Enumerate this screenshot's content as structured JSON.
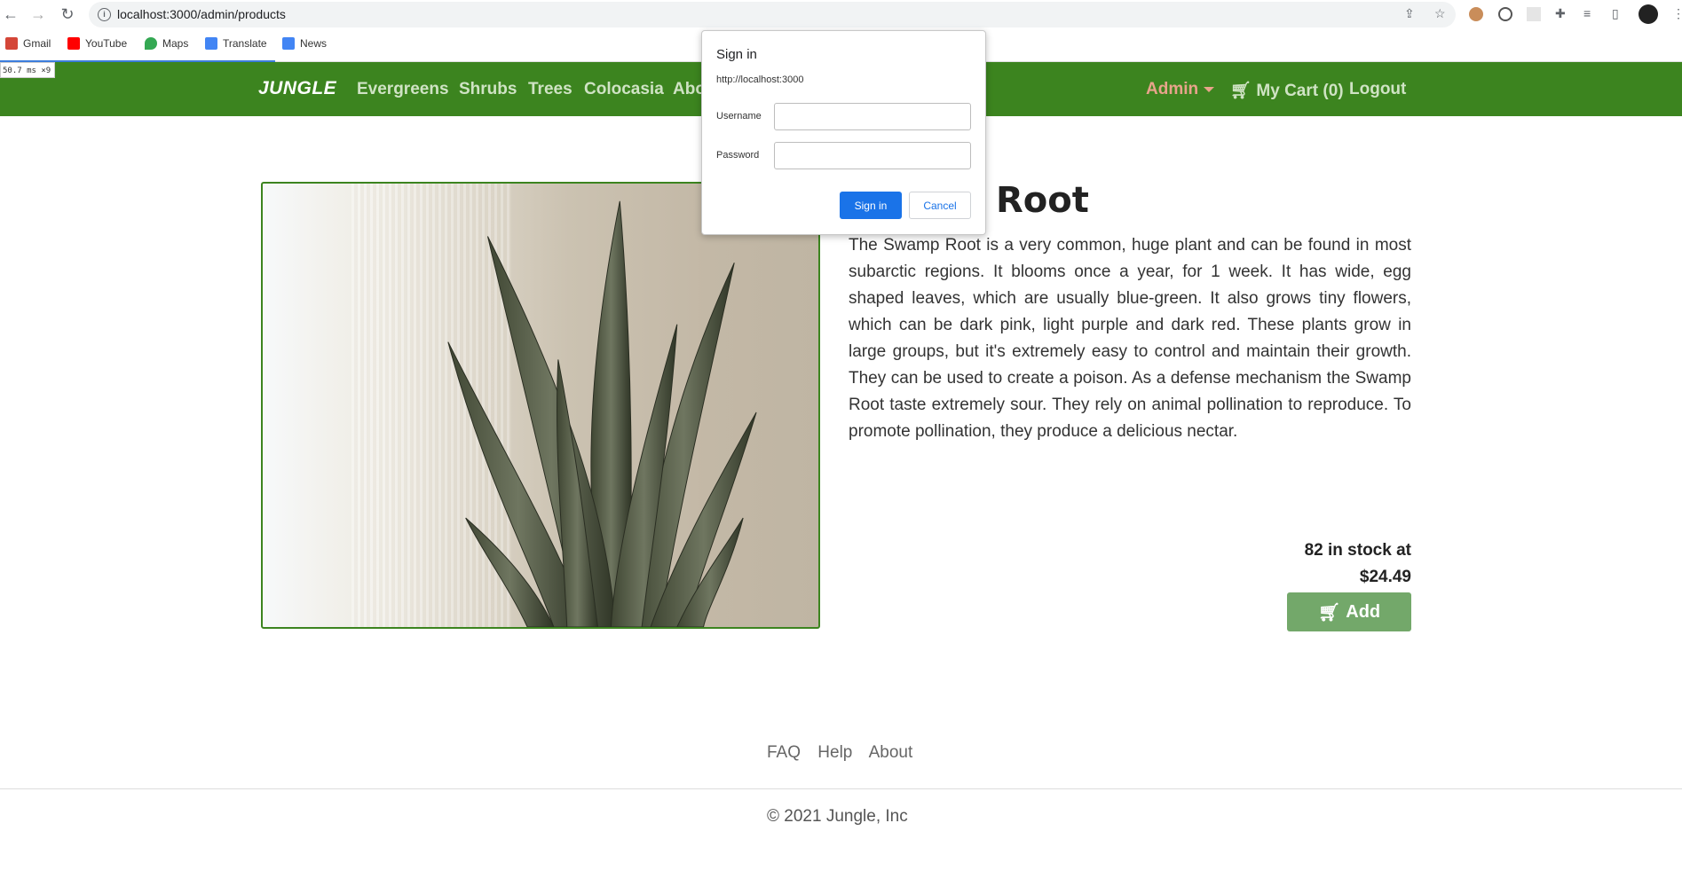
{
  "browser": {
    "url": "localhost:3000/admin/products",
    "bookmarks": [
      {
        "label": "Gmail",
        "icon": "gmail-icon",
        "color": "#d44638"
      },
      {
        "label": "YouTube",
        "icon": "youtube-icon",
        "color": "#ff0000"
      },
      {
        "label": "Maps",
        "icon": "maps-icon",
        "color": "#34a853"
      },
      {
        "label": "Translate",
        "icon": "translate-icon",
        "color": "#4285f4"
      },
      {
        "label": "News",
        "icon": "news-icon",
        "color": "#4285f4"
      }
    ],
    "timing": "50.7 ms ×9"
  },
  "site": {
    "brand": "JUNGLE",
    "nav": {
      "evergreens": "Evergreens",
      "shrubs": "Shrubs",
      "trees": "Trees",
      "colocasia": "Colocasia",
      "about": "Abo",
      "admin": "Admin",
      "cart": "My Cart (0)",
      "logout": "Logout"
    },
    "colors": {
      "nav_bg": "#3c841f",
      "add_button": "#73a86a",
      "admin": "#e8a48b"
    }
  },
  "product": {
    "title": "Root",
    "description": "The Swamp Root is a very common, huge plant and can be found in most subarctic regions. It blooms once a year, for 1 week. It has wide, egg shaped leaves, which are usually blue-green. It also grows tiny flowers, which can be dark pink, light purple and dark red. These plants grow in large groups, but it's extremely easy to control and maintain their growth. They can be used to create a poison. As a defense mechanism the Swamp Root taste extremely sour. They rely on animal pollination to reproduce. To promote pollination, they produce a delicious nectar.",
    "stock": "82 in stock at",
    "price": "$24.49",
    "add_label": "Add"
  },
  "footer": {
    "links": [
      "FAQ",
      "Help",
      "About"
    ],
    "copyright": "© 2021 Jungle, Inc"
  },
  "dialog": {
    "title": "Sign in",
    "origin": "http://localhost:3000",
    "username_label": "Username",
    "password_label": "Password",
    "username_value": "",
    "password_value": "",
    "signin_label": "Sign in",
    "cancel_label": "Cancel"
  }
}
